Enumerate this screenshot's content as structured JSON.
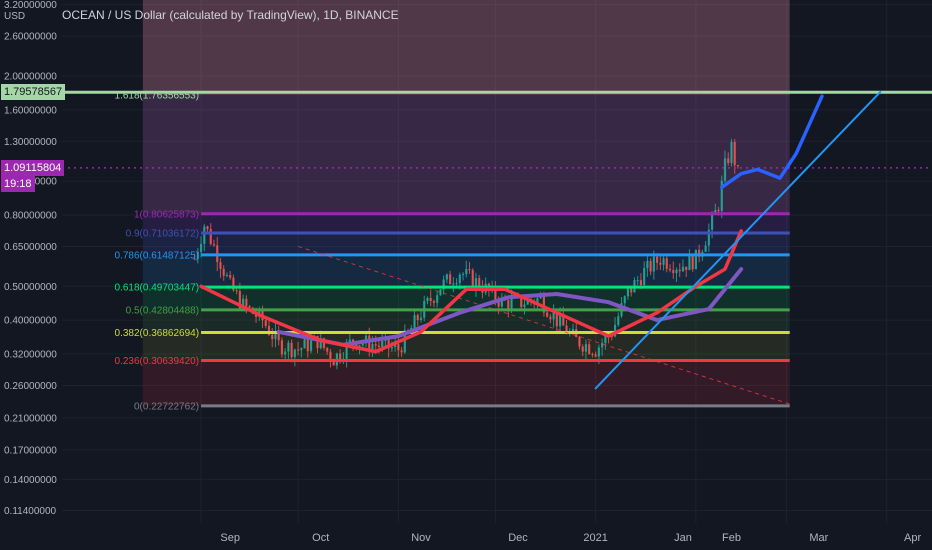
{
  "header": {
    "symbol": "OCEAN / US Dollar (calculated by TradingView)",
    "interval": "1D",
    "exchange": "BINANCE",
    "sep": ", "
  },
  "price_axis": {
    "currency": "USD",
    "ticks": [
      "3.20000000",
      "2.60000000",
      "2.00000000",
      "1.60000000",
      "1.30000000",
      "1.00000000",
      "0.80000000",
      "0.65000000",
      "0.50000000",
      "0.40000000",
      "0.32000000",
      "0.26000000",
      "0.21000000",
      "0.17000000",
      "0.14000000",
      "0.11400000"
    ]
  },
  "tags": {
    "resistance": {
      "value": "1.79578567",
      "bg": "#a5d6a7",
      "fg": "#131722"
    },
    "last_price": {
      "value": "1.09115804",
      "bg": "#9c27b0",
      "fg": "#ffffff"
    },
    "countdown": {
      "value": "19:18",
      "bg": "#9c27b0",
      "fg": "#ffffff"
    }
  },
  "time_axis": {
    "labels": [
      "Sep",
      "Oct",
      "Nov",
      "Dec",
      "2021",
      "Jan",
      "Feb",
      "Mar",
      "Apr"
    ]
  },
  "colors": {
    "background": "#131722",
    "bull": "#26a69a",
    "bear": "#ef5350",
    "grid": "#1e222d",
    "ma_fast": "#f23645",
    "ma_slow": "#7e57c2",
    "trendline": "#2196f3",
    "projection": "#2962ff",
    "last_price_line": "#9c27b0",
    "resistance_line": "#a5d6a7"
  },
  "chart_data": {
    "type": "candlestick",
    "title": "OCEAN / US Dollar (calculated by TradingView), 1D, BINANCE",
    "scale": "log",
    "ylim": [
      0.105,
      3.3
    ],
    "x_range": [
      "2020-07-20",
      "2021-04-15"
    ],
    "series_points": {
      "ma_fast": [
        [
          "2020-09-01",
          0.5
        ],
        [
          "2020-09-20",
          0.41
        ],
        [
          "2020-10-08",
          0.35
        ],
        [
          "2020-10-25",
          0.325
        ],
        [
          "2020-11-08",
          0.37
        ],
        [
          "2020-11-22",
          0.49
        ],
        [
          "2020-12-04",
          0.49
        ],
        [
          "2020-12-20",
          0.42
        ],
        [
          "2021-01-05",
          0.36
        ],
        [
          "2021-01-20",
          0.42
        ],
        [
          "2021-02-01",
          0.5
        ],
        [
          "2021-02-10",
          0.56
        ],
        [
          "2021-02-15",
          0.72
        ]
      ],
      "ma_slow": [
        [
          "2020-09-25",
          0.37
        ],
        [
          "2020-10-15",
          0.34
        ],
        [
          "2020-11-01",
          0.36
        ],
        [
          "2020-11-20",
          0.42
        ],
        [
          "2020-12-05",
          0.465
        ],
        [
          "2020-12-20",
          0.475
        ],
        [
          "2021-01-05",
          0.45
        ],
        [
          "2021-01-20",
          0.4
        ],
        [
          "2021-02-05",
          0.43
        ],
        [
          "2021-02-15",
          0.56
        ]
      ],
      "trendline": [
        [
          "2021-01-01",
          0.255
        ],
        [
          "2021-03-30",
          1.8
        ]
      ],
      "projection": [
        [
          "2021-02-09",
          0.96
        ],
        [
          "2021-02-15",
          1.05
        ],
        [
          "2021-02-20",
          1.08
        ],
        [
          "2021-02-27",
          1.02
        ],
        [
          "2021-03-04",
          1.2
        ],
        [
          "2021-03-12",
          1.75
        ]
      ],
      "descending_trend": [
        [
          "2020-10-01",
          0.65
        ],
        [
          "2021-03-02",
          0.23
        ]
      ],
      "price_path": [
        [
          "2020-08-30",
          0.6
        ],
        [
          "2020-09-02",
          0.75
        ],
        [
          "2020-09-06",
          0.62
        ],
        [
          "2020-09-10",
          0.5
        ],
        [
          "2020-09-14",
          0.44
        ],
        [
          "2020-09-20",
          0.4
        ],
        [
          "2020-09-25",
          0.34
        ],
        [
          "2020-10-01",
          0.33
        ],
        [
          "2020-10-07",
          0.35
        ],
        [
          "2020-10-12",
          0.31
        ],
        [
          "2020-10-18",
          0.35
        ],
        [
          "2020-10-25",
          0.34
        ],
        [
          "2020-11-01",
          0.33
        ],
        [
          "2020-11-08",
          0.42
        ],
        [
          "2020-11-14",
          0.5
        ],
        [
          "2020-11-20",
          0.55
        ],
        [
          "2020-11-27",
          0.5
        ],
        [
          "2020-12-03",
          0.45
        ],
        [
          "2020-12-09",
          0.45
        ],
        [
          "2020-12-15",
          0.46
        ],
        [
          "2020-12-20",
          0.4
        ],
        [
          "2020-12-26",
          0.35
        ],
        [
          "2021-01-01",
          0.33
        ],
        [
          "2021-01-06",
          0.37
        ],
        [
          "2021-01-11",
          0.48
        ],
        [
          "2021-01-16",
          0.55
        ],
        [
          "2021-01-21",
          0.6
        ],
        [
          "2021-01-27",
          0.57
        ],
        [
          "2021-02-01",
          0.6
        ],
        [
          "2021-02-05",
          0.72
        ],
        [
          "2021-02-08",
          0.86
        ],
        [
          "2021-02-10",
          1.1
        ],
        [
          "2021-02-12",
          1.25
        ],
        [
          "2021-02-14",
          1.05
        ]
      ]
    },
    "fibonacci": {
      "x_start": "2020-09-01",
      "x_end": "2021-03-02",
      "zone_start": "2020-08-14",
      "zone_top": 3.3,
      "levels": [
        {
          "label": "1.618(1.76356553)",
          "value": 1.76356553,
          "color": "#a5d6a7",
          "line": false
        },
        {
          "label": "1(0.80625873)",
          "value": 0.80625873,
          "color": "#9c27b0",
          "line": true
        },
        {
          "label": "0.9(0.71036172)",
          "value": 0.71036172,
          "color": "#3f51b5",
          "line": true
        },
        {
          "label": "0.786(0.61487125)",
          "value": 0.61487125,
          "color": "#2196f3",
          "line": true
        },
        {
          "label": "0.618(0.49703447)",
          "value": 0.49703447,
          "color": "#00e676",
          "line": true
        },
        {
          "label": "0.5(0.42804488)",
          "value": 0.42804488,
          "color": "#43a047",
          "line": true
        },
        {
          "label": "0.382(0.36862694)",
          "value": 0.36862694,
          "color": "#cddc39",
          "line": true
        },
        {
          "label": "0.236(0.30639420)",
          "value": 0.3063942,
          "color": "#f23645",
          "line": true
        },
        {
          "label": "0(0.22722762)",
          "value": 0.22722762,
          "color": "#787b86",
          "line": true
        }
      ]
    },
    "horizontal_lines": [
      {
        "name": "resistance",
        "value": 1.79578567
      },
      {
        "name": "last_price",
        "value": 1.09115804
      }
    ]
  }
}
